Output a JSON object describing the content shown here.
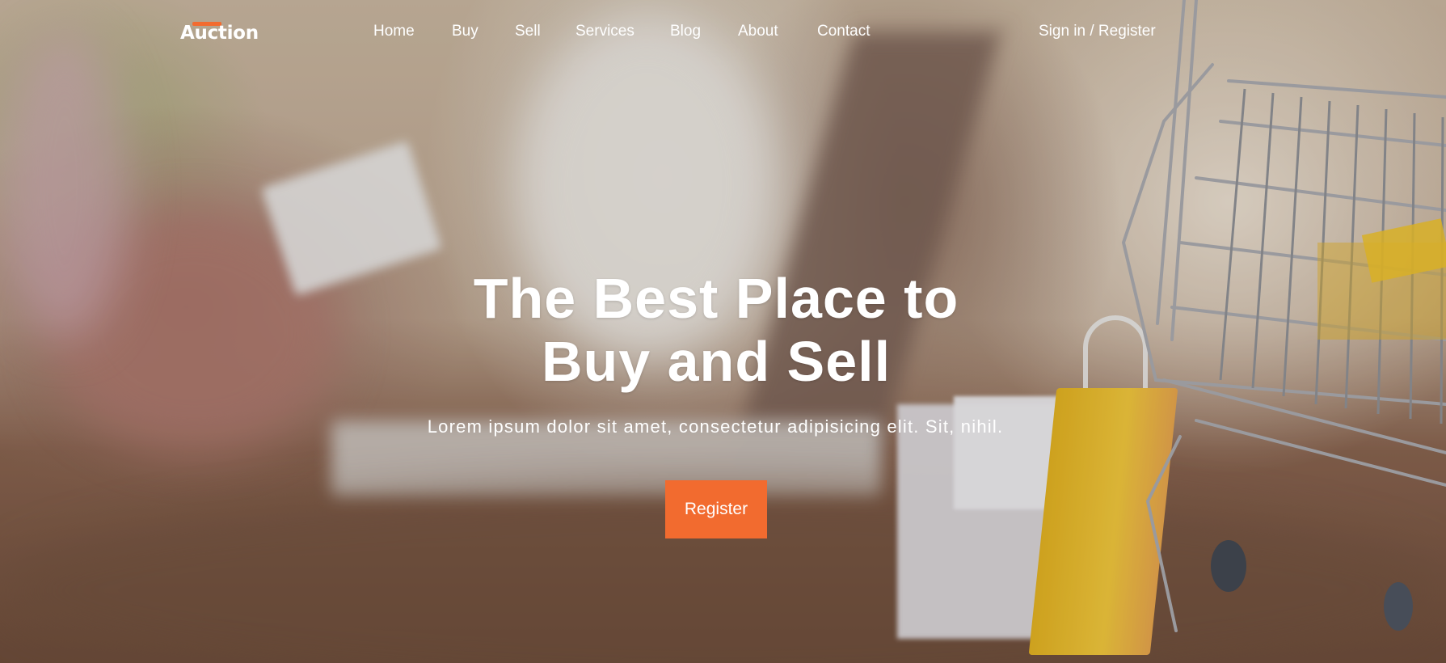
{
  "brand": {
    "name": "Auction",
    "accent_color": "#f26b2f"
  },
  "nav": {
    "items": [
      {
        "label": "Home"
      },
      {
        "label": "Buy"
      },
      {
        "label": "Sell"
      },
      {
        "label": "Services"
      },
      {
        "label": "Blog"
      },
      {
        "label": "About"
      },
      {
        "label": "Contact"
      }
    ],
    "signin_label": "Sign in / Register"
  },
  "hero": {
    "title_line1": "The Best Place to",
    "title_line2": "Buy and Sell",
    "subtitle": "Lorem ipsum dolor sit amet, consectetur adipisicing elit. Sit, nihil.",
    "cta_label": "Register",
    "cta_color": "#f26b2f"
  }
}
